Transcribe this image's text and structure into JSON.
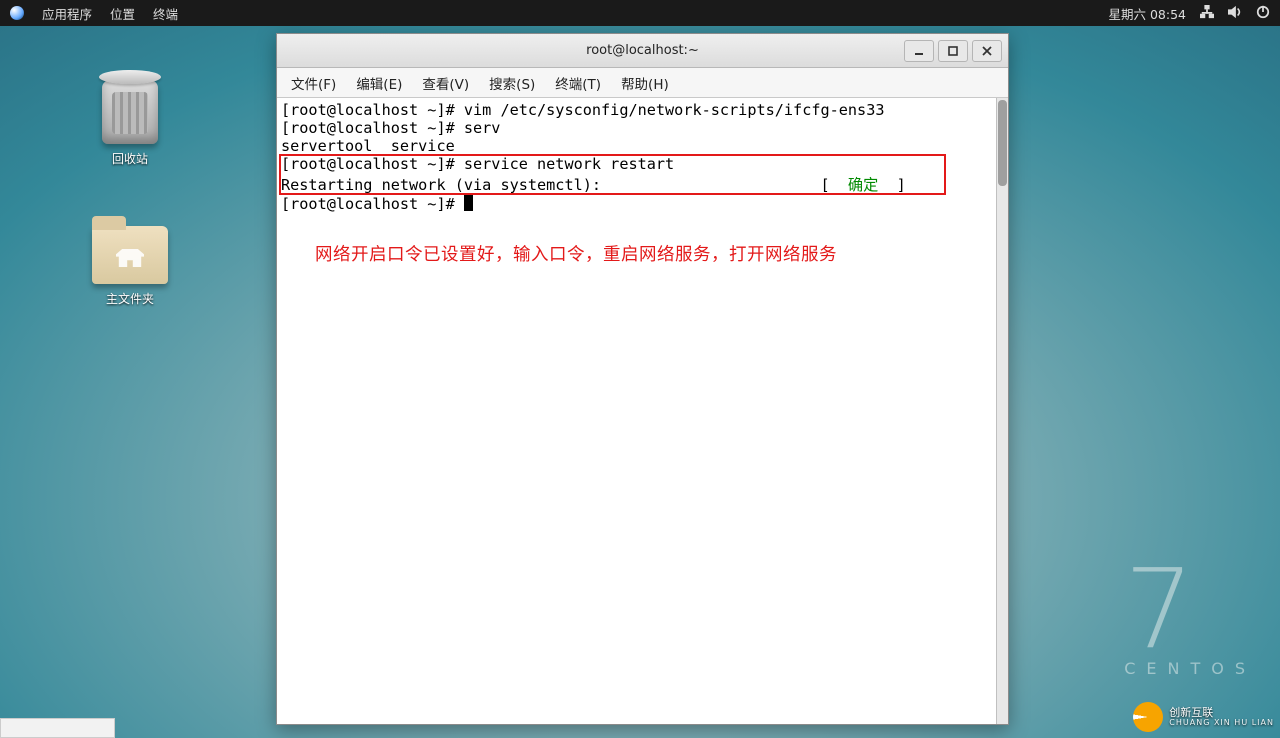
{
  "topbar": {
    "menus": [
      "应用程序",
      "位置",
      "终端"
    ],
    "datetime": "星期六 08:54"
  },
  "desktop": {
    "trash_label": "回收站",
    "home_label": "主文件夹"
  },
  "branding": {
    "digit": "7",
    "name": "CENTOS"
  },
  "watermark": {
    "main": "创新互联",
    "sub": "CHUANG XIN HU LIAN"
  },
  "window": {
    "title": "root@localhost:~",
    "menus": [
      "文件(F)",
      "编辑(E)",
      "查看(V)",
      "搜索(S)",
      "终端(T)",
      "帮助(H)"
    ]
  },
  "terminal": {
    "line1": "[root@localhost ~]# vim /etc/sysconfig/network-scripts/ifcfg-ens33",
    "line2": "[root@localhost ~]# serv",
    "line3": "servertool  service",
    "line4": "[root@localhost ~]# service network restart",
    "line5a": "Restarting network (via systemctl):                        [  ",
    "line5_ok": "确定",
    "line5b": "  ]",
    "line6": "[root@localhost ~]# "
  },
  "annotation": "网络开启口令已设置好，输入口令，重启网络服务，打开网络服务"
}
